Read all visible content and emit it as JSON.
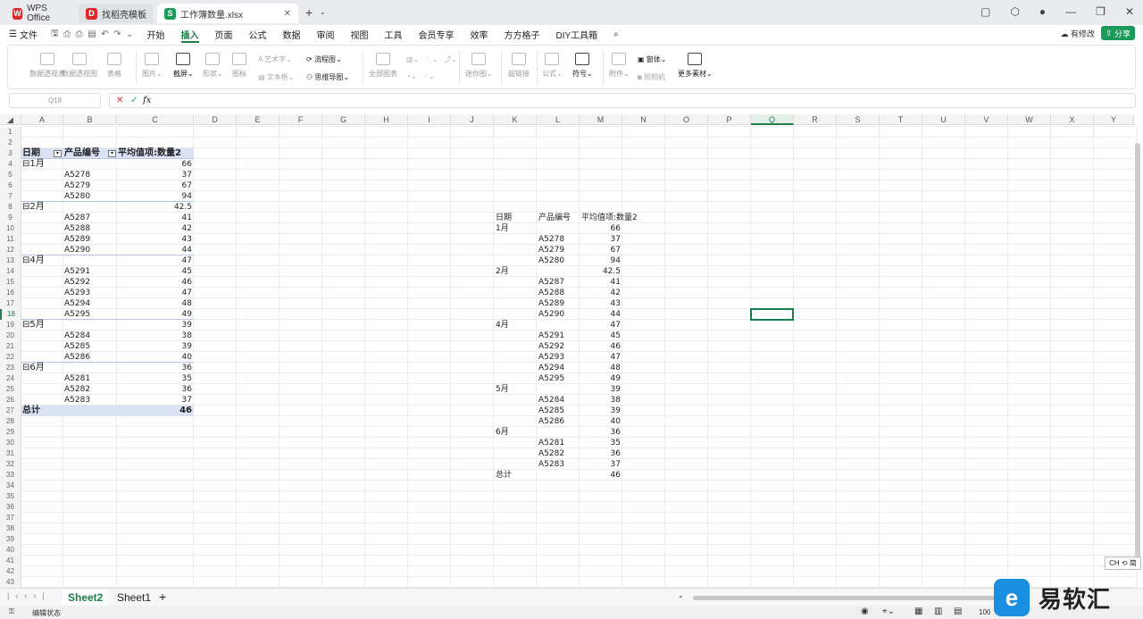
{
  "titlebar": {
    "tabs": [
      {
        "label": "WPS Office",
        "logo": "W"
      },
      {
        "label": "找稻壳模板",
        "logo": "D"
      },
      {
        "label": "工作簿数量.xlsx",
        "logo": "S"
      }
    ],
    "new_tab": "+"
  },
  "menu": {
    "file": "文件",
    "items": [
      "开始",
      "插入",
      "页面",
      "公式",
      "数据",
      "审阅",
      "视图",
      "工具",
      "会员专享",
      "效率",
      "方方格子",
      "DIY工具箱"
    ],
    "active_index": 1,
    "modified": "有修改",
    "share": "分享"
  },
  "ribbon": {
    "pivot_table": "数据透视表",
    "pivot_chart": "数据透视图",
    "table": "表格",
    "picture": "图片",
    "screenshot": "截屏",
    "shape": "形状",
    "icon": "图标",
    "art_text": "艺术字",
    "flowchart": "流程图",
    "textbox": "文本框",
    "mindmap": "思维导图",
    "all_charts": "全部图表",
    "sparkline": "迷你图",
    "hyperlink": "超链接",
    "formula": "公式",
    "symbol": "符号",
    "attachment": "附件",
    "camera": "照相机",
    "form": "窗体",
    "more": "更多素材"
  },
  "formula_bar": {
    "name_box": "Q18",
    "fx": "fx",
    "cancel": "✕",
    "confirm": "✓"
  },
  "columns": [
    "A",
    "B",
    "C",
    "D",
    "E",
    "F",
    "G",
    "H",
    "I",
    "J",
    "K",
    "L",
    "M",
    "N",
    "O",
    "P",
    "Q",
    "R",
    "S",
    "T",
    "U",
    "V",
    "W",
    "X",
    "Y"
  ],
  "selected_column": "Q",
  "selected_row": 18,
  "rows": [
    1,
    2,
    3,
    4,
    5,
    6,
    7,
    8,
    9,
    10,
    11,
    12,
    13,
    14,
    15,
    16,
    17,
    18,
    19,
    20,
    21,
    22,
    23,
    24,
    25,
    26,
    27,
    28,
    29,
    30,
    31,
    32,
    33,
    34,
    35,
    36,
    37,
    38,
    39,
    40,
    41,
    42,
    43
  ],
  "pivot": {
    "headers": [
      "日期",
      "产品编号",
      "平均值项:数量2"
    ],
    "rows": [
      {
        "r": 4,
        "a": "⊟1月",
        "b": "",
        "c": "66",
        "group": true
      },
      {
        "r": 5,
        "a": "",
        "b": "A5278",
        "c": "37"
      },
      {
        "r": 6,
        "a": "",
        "b": "A5279",
        "c": "67"
      },
      {
        "r": 7,
        "a": "",
        "b": "A5280",
        "c": "94"
      },
      {
        "r": 8,
        "a": "⊟2月",
        "b": "",
        "c": "42.5",
        "group": true
      },
      {
        "r": 9,
        "a": "",
        "b": "A5287",
        "c": "41"
      },
      {
        "r": 10,
        "a": "",
        "b": "A5288",
        "c": "42"
      },
      {
        "r": 11,
        "a": "",
        "b": "A5289",
        "c": "43"
      },
      {
        "r": 12,
        "a": "",
        "b": "A5290",
        "c": "44"
      },
      {
        "r": 13,
        "a": "⊟4月",
        "b": "",
        "c": "47",
        "group": true
      },
      {
        "r": 14,
        "a": "",
        "b": "A5291",
        "c": "45"
      },
      {
        "r": 15,
        "a": "",
        "b": "A5292",
        "c": "46"
      },
      {
        "r": 16,
        "a": "",
        "b": "A5293",
        "c": "47"
      },
      {
        "r": 17,
        "a": "",
        "b": "A5294",
        "c": "48"
      },
      {
        "r": 18,
        "a": "",
        "b": "A5295",
        "c": "49"
      },
      {
        "r": 19,
        "a": "⊟5月",
        "b": "",
        "c": "39",
        "group": true
      },
      {
        "r": 20,
        "a": "",
        "b": "A5284",
        "c": "38"
      },
      {
        "r": 21,
        "a": "",
        "b": "A5285",
        "c": "39"
      },
      {
        "r": 22,
        "a": "",
        "b": "A5286",
        "c": "40"
      },
      {
        "r": 23,
        "a": "⊟6月",
        "b": "",
        "c": "36",
        "group": true
      },
      {
        "r": 24,
        "a": "",
        "b": "A5281",
        "c": "35"
      },
      {
        "r": 25,
        "a": "",
        "b": "A5282",
        "c": "36"
      },
      {
        "r": 26,
        "a": "",
        "b": "A5283",
        "c": "37"
      }
    ],
    "total": {
      "label": "总计",
      "value": "46"
    }
  },
  "copy_table": {
    "headers": [
      "日期",
      "产品编号",
      "平均值项:数量2"
    ],
    "rows": [
      {
        "a": "1月",
        "b": "",
        "c": "66"
      },
      {
        "a": "",
        "b": "A5278",
        "c": "37"
      },
      {
        "a": "",
        "b": "A5279",
        "c": "67"
      },
      {
        "a": "",
        "b": "A5280",
        "c": "94"
      },
      {
        "a": "2月",
        "b": "",
        "c": "42.5"
      },
      {
        "a": "",
        "b": "A5287",
        "c": "41"
      },
      {
        "a": "",
        "b": "A5288",
        "c": "42"
      },
      {
        "a": "",
        "b": "A5289",
        "c": "43"
      },
      {
        "a": "",
        "b": "A5290",
        "c": "44"
      },
      {
        "a": "4月",
        "b": "",
        "c": "47"
      },
      {
        "a": "",
        "b": "A5291",
        "c": "45"
      },
      {
        "a": "",
        "b": "A5292",
        "c": "46"
      },
      {
        "a": "",
        "b": "A5293",
        "c": "47"
      },
      {
        "a": "",
        "b": "A5294",
        "c": "48"
      },
      {
        "a": "",
        "b": "A5295",
        "c": "49"
      },
      {
        "a": "5月",
        "b": "",
        "c": "39"
      },
      {
        "a": "",
        "b": "A5284",
        "c": "38"
      },
      {
        "a": "",
        "b": "A5285",
        "c": "39"
      },
      {
        "a": "",
        "b": "A5286",
        "c": "40"
      },
      {
        "a": "6月",
        "b": "",
        "c": "36"
      },
      {
        "a": "",
        "b": "A5281",
        "c": "35"
      },
      {
        "a": "",
        "b": "A5282",
        "c": "36"
      },
      {
        "a": "",
        "b": "A5283",
        "c": "37"
      },
      {
        "a": "总计",
        "b": "",
        "c": "46"
      }
    ]
  },
  "sheets": [
    "Sheet2",
    "Sheet1"
  ],
  "active_sheet": "Sheet2",
  "status": {
    "mode": "编辑状态",
    "zoom": "100",
    "ime": "CH ⟲ 简"
  },
  "watermark": {
    "logo": "e",
    "text": "易软汇"
  },
  "colors": {
    "accent": "#1b7f47",
    "pivot_header": "#d9e1f2"
  }
}
